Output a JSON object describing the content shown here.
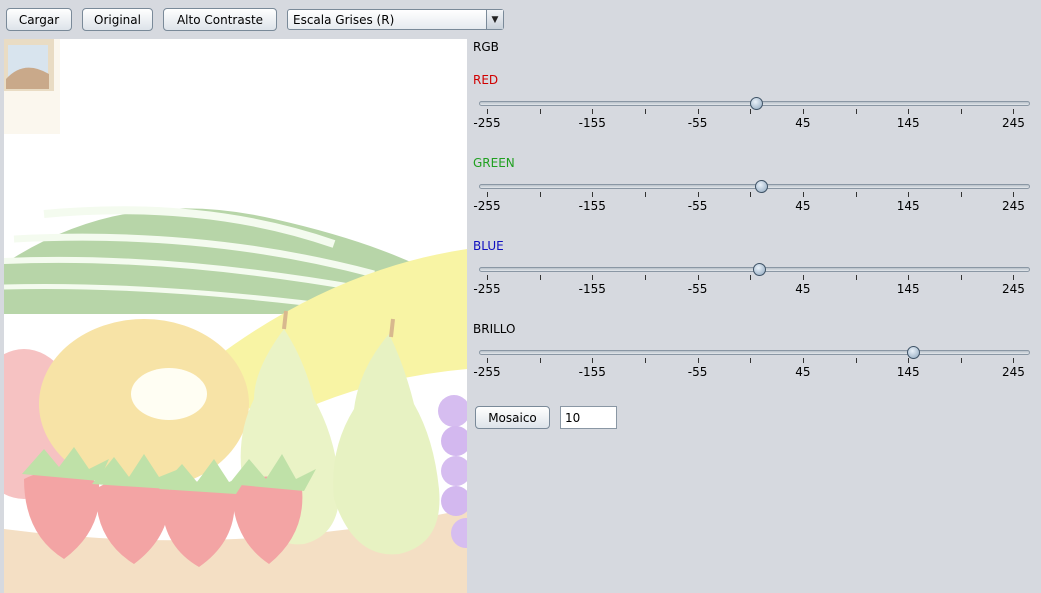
{
  "toolbar": {
    "load_label": "Cargar",
    "original_label": "Original",
    "contrast_label": "Alto Contraste",
    "filter_selected": "Escala Grises (R)"
  },
  "panel": {
    "mode_label": "RGB",
    "tick_labels": [
      "-255",
      "-155",
      "-55",
      "45",
      "145",
      "245"
    ],
    "sliders": [
      {
        "label": "RED",
        "color": "#d00000",
        "value": 0
      },
      {
        "label": "GREEN",
        "color": "#20a020",
        "value": 5
      },
      {
        "label": "BLUE",
        "color": "#1010c0",
        "value": 3
      },
      {
        "label": "BRILLO",
        "color": "#000000",
        "value": 150
      }
    ],
    "mosaic_label": "Mosaico",
    "mosaic_value": "10"
  },
  "image": {
    "subject": "fruit-bowl"
  }
}
